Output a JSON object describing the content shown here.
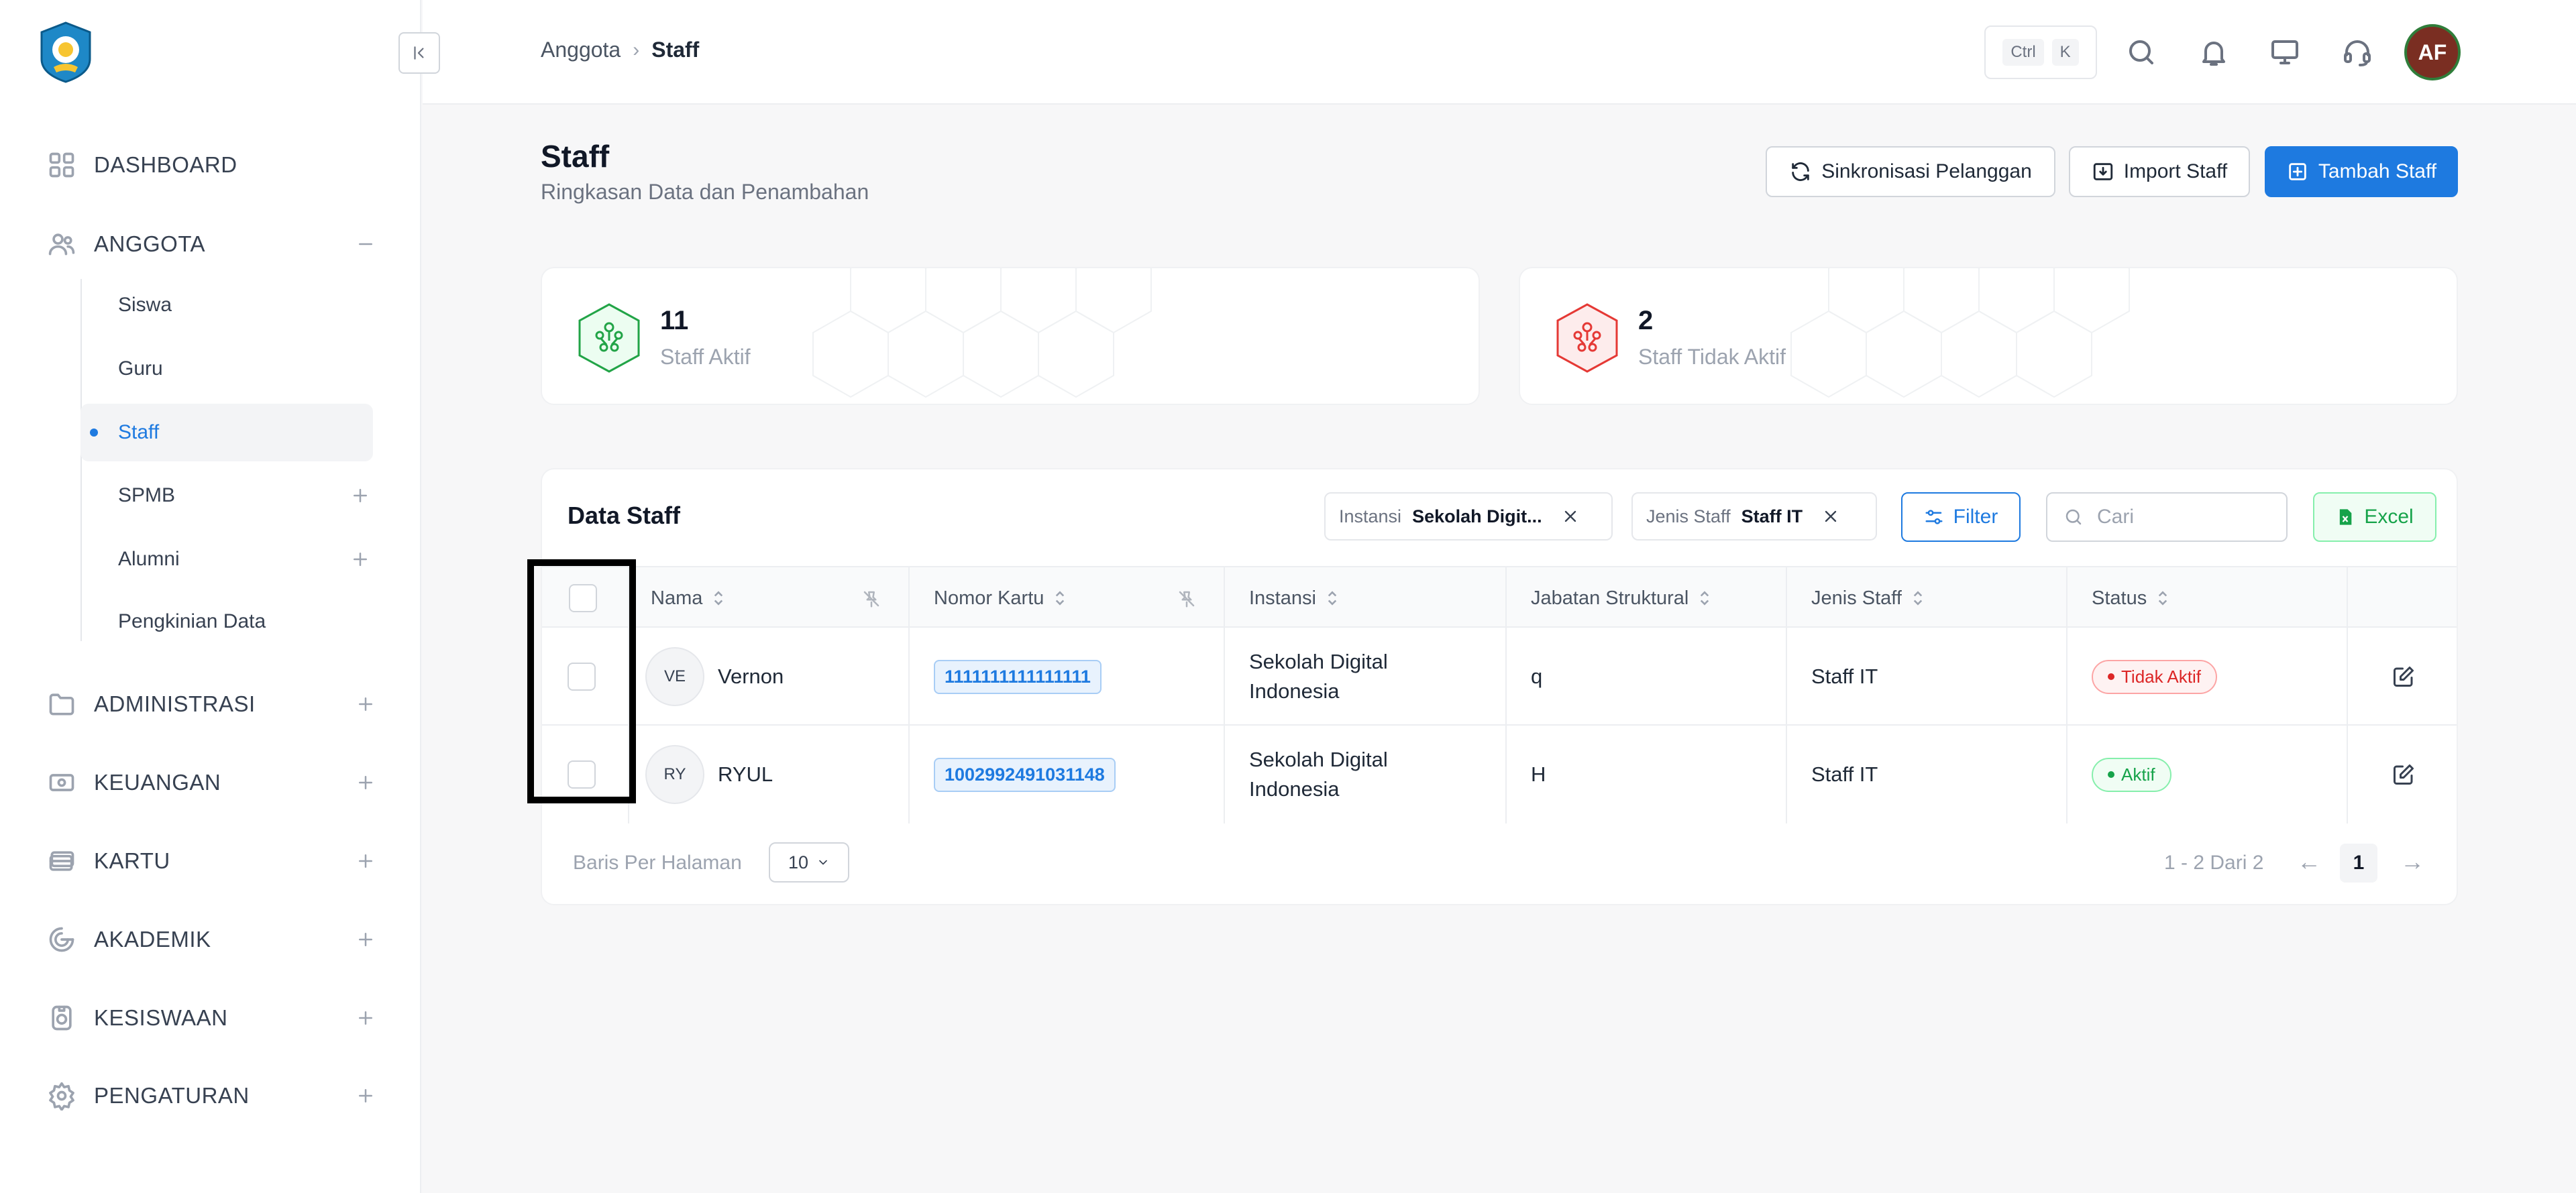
{
  "sidebar": {
    "items": [
      {
        "label": "DASHBOARD",
        "icon": "dashboard-grid-icon"
      },
      {
        "label": "ANGGOTA",
        "icon": "users-icon",
        "toggle": "minus"
      },
      {
        "label": "ADMINISTRASI",
        "icon": "folder-icon",
        "toggle": "plus"
      },
      {
        "label": "KEUANGAN",
        "icon": "money-icon",
        "toggle": "plus"
      },
      {
        "label": "KARTU",
        "icon": "card-icon",
        "toggle": "plus"
      },
      {
        "label": "AKADEMIK",
        "icon": "academic-icon",
        "toggle": "plus"
      },
      {
        "label": "KESISWAAN",
        "icon": "student-icon",
        "toggle": "plus"
      },
      {
        "label": "PENGATURAN",
        "icon": "gear-icon",
        "toggle": "plus"
      }
    ],
    "sub_items": [
      {
        "label": "Siswa"
      },
      {
        "label": "Guru"
      },
      {
        "label": "Staff",
        "active": true
      },
      {
        "label": "SPMB",
        "toggle": "plus"
      },
      {
        "label": "Alumni",
        "toggle": "plus"
      },
      {
        "label": "Pengkinian Data"
      }
    ]
  },
  "header": {
    "breadcrumb": [
      "Anggota",
      "Staff"
    ],
    "shortcut": [
      "Ctrl",
      "K"
    ],
    "avatar_initials": "AF"
  },
  "page": {
    "title": "Staff",
    "subtitle": "Ringkasan Data dan Penambahan",
    "buttons": {
      "sync": "Sinkronisasi Pelanggan",
      "import": "Import Staff",
      "add": "Tambah Staff"
    }
  },
  "stats": [
    {
      "value": "11",
      "label": "Staff Aktif",
      "color": "#22a447"
    },
    {
      "value": "2",
      "label": "Staff Tidak Aktif",
      "color": "#e53935"
    }
  ],
  "table": {
    "title": "Data Staff",
    "filters": [
      {
        "key": "Instansi",
        "value": "Sekolah Digit..."
      },
      {
        "key": "Jenis Staff",
        "value": "Staff IT"
      }
    ],
    "filter_label": "Filter",
    "search_placeholder": "Cari",
    "excel_label": "Excel",
    "columns": [
      "Nama",
      "Nomor Kartu",
      "Instansi",
      "Jabatan Struktural",
      "Jenis Staff",
      "Status"
    ],
    "rows": [
      {
        "initials": "VE",
        "name": "Vernon",
        "card": "1111111111111111",
        "instansi_1": "Sekolah Digital",
        "instansi_2": "Indonesia",
        "jabatan": "q",
        "jenis": "Staff IT",
        "status": "Tidak Aktif",
        "active": false
      },
      {
        "initials": "RY",
        "name": "RYUL",
        "card": "1002992491031148",
        "instansi_1": "Sekolah Digital",
        "instansi_2": "Indonesia",
        "jabatan": "H",
        "jenis": "Staff IT",
        "status": "Aktif",
        "active": true
      }
    ],
    "footer": {
      "rows_per_page_label": "Baris Per Halaman",
      "rows_per_page": "10",
      "range": "1 - 2 Dari 2",
      "prev": "←",
      "current_page": "1",
      "next": "→"
    }
  }
}
